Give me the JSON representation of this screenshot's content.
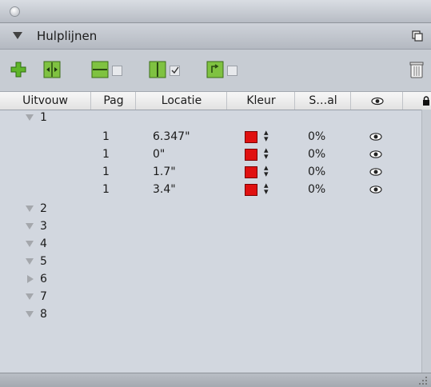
{
  "panel": {
    "title": "Hulplijnen"
  },
  "toolbar": {
    "buttons": [
      {
        "icon": "add-guide-icon"
      },
      {
        "icon": "distribute-guides-icon"
      },
      {
        "icon": "horizontal-guide-icon",
        "checked": false
      },
      {
        "icon": "vertical-guide-icon",
        "checked": true
      },
      {
        "icon": "snap-guide-icon",
        "checked": false
      },
      {
        "icon": "trash-icon"
      }
    ]
  },
  "columns": [
    "Uitvouw",
    "Pag",
    "Locatie",
    "Kleur",
    "S…al",
    "eye-icon",
    "lock-icon"
  ],
  "groups": [
    {
      "label": "1",
      "expanded": true,
      "guides": [
        {
          "page": "1",
          "location": "6.347\"",
          "color": "#e01010",
          "scale": "0%",
          "visible": true
        },
        {
          "page": "1",
          "location": "0\"",
          "color": "#e01010",
          "scale": "0%",
          "visible": true
        },
        {
          "page": "1",
          "location": "1.7\"",
          "color": "#e01010",
          "scale": "0%",
          "visible": true
        },
        {
          "page": "1",
          "location": "3.4\"",
          "color": "#e01010",
          "scale": "0%",
          "visible": true
        }
      ]
    },
    {
      "label": "2",
      "expanded": true,
      "guides": []
    },
    {
      "label": "3",
      "expanded": true,
      "guides": []
    },
    {
      "label": "4",
      "expanded": true,
      "guides": []
    },
    {
      "label": "5",
      "expanded": true,
      "guides": []
    },
    {
      "label": "6",
      "expanded": false,
      "guides": []
    },
    {
      "label": "7",
      "expanded": true,
      "guides": []
    },
    {
      "label": "8",
      "expanded": true,
      "guides": []
    }
  ]
}
